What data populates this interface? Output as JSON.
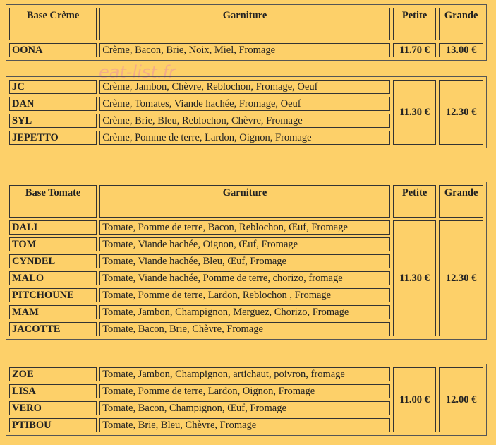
{
  "watermark": "eat-list.fr",
  "creme": {
    "head": {
      "base": "Base Crème",
      "garniture": "Garniture",
      "petite": "Petite",
      "grande": "Grande"
    },
    "oona": {
      "name": "OONA",
      "desc": "Crème, Bacon, Brie, Noix, Miel, Fromage",
      "petite": "11.70 €",
      "grande": "13.00 €"
    },
    "group": {
      "items": [
        {
          "name": "JC",
          "desc": "Crème, Jambon, Chèvre, Reblochon, Fromage, Oeuf"
        },
        {
          "name": "DAN",
          "desc": "Crème, Tomates, Viande hachée, Fromage, Oeuf"
        },
        {
          "name": "SYL",
          "desc": "Crème, Brie, Bleu, Reblochon, Chèvre, Fromage"
        },
        {
          "name": "JEPETTO",
          "desc": "Crème, Pomme de terre, Lardon, Oignon, Fromage"
        }
      ],
      "petite": "11.30 €",
      "grande": "12.30 €"
    }
  },
  "tomate": {
    "head": {
      "base": "Base Tomate",
      "garniture": "Garniture",
      "petite": "Petite",
      "grande": "Grande"
    },
    "group1": {
      "items": [
        {
          "name": "DALI",
          "desc": "Tomate, Pomme de terre, Bacon, Reblochon, Œuf, Fromage"
        },
        {
          "name": "TOM",
          "desc": "Tomate, Viande hachée, Oignon, Œuf, Fromage"
        },
        {
          "name": "CYNDEL",
          "desc": "Tomate, Viande hachée, Bleu, Œuf, Fromage"
        },
        {
          "name": "MALO",
          "desc": "Tomate, Viande hachée, Pomme de terre, chorizo, fromage"
        },
        {
          "name": "PITCHOUNE",
          "desc": "Tomate, Pomme de terre, Lardon, Reblochon , Fromage"
        },
        {
          "name": "MAM",
          "desc": "Tomate, Jambon, Champignon, Merguez, Chorizo, Fromage"
        },
        {
          "name": "JACOTTE",
          "desc": "Tomate, Bacon, Brie, Chèvre, Fromage"
        }
      ],
      "petite": "11.30 €",
      "grande": "12.30 €"
    },
    "group2": {
      "items": [
        {
          "name": "ZOE",
          "desc": "Tomate, Jambon, Champignon, artichaut, poivron, fromage"
        },
        {
          "name": "LISA",
          "desc": "Tomate, Pomme de terre, Lardon, Oignon, Fromage"
        },
        {
          "name": "VERO",
          "desc": "Tomate, Bacon, Champignon, Œuf, Fromage"
        },
        {
          "name": "PTIBOU",
          "desc": "Tomate, Brie, Bleu, Chèvre, Fromage"
        }
      ],
      "petite": "11.00 €",
      "grande": "12.00 €"
    }
  }
}
